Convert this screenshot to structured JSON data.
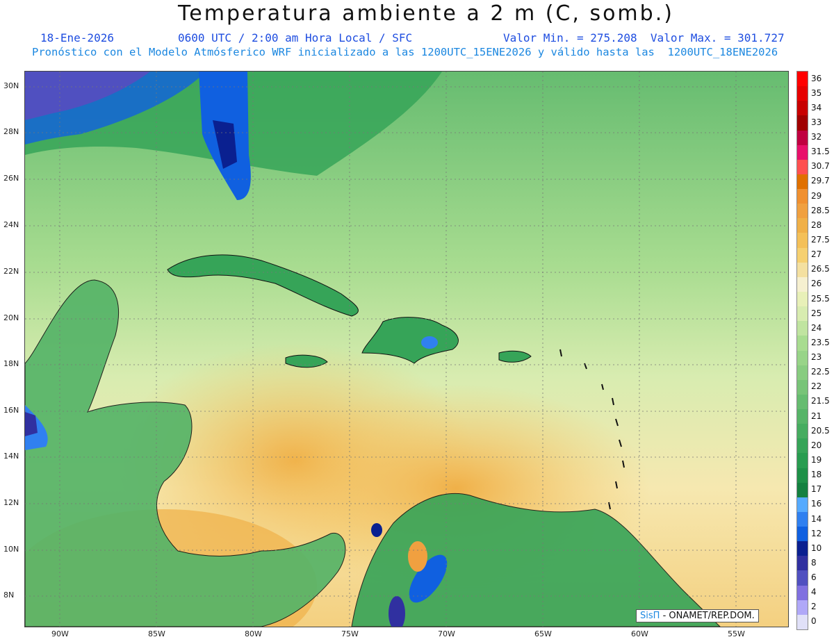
{
  "title": "Temperatura ambiente a 2 m (C, somb.)",
  "header": {
    "date": "18-Ene-2026",
    "time": "0600 UTC / 2:00 am Hora Local / SFC",
    "values": "Valor Min. = 275.208  Valor Max. = 301.727",
    "forecast": "Pronóstico con el Modelo Atmósferico WRF inicializado a las 1200UTC_15ENE2026 y válido hasta las  1200UTC_18ENE2026"
  },
  "axes": {
    "lat_labels": [
      "30N",
      "28N",
      "26N",
      "24N",
      "22N",
      "20N",
      "18N",
      "16N",
      "14N",
      "12N",
      "10N",
      "8N"
    ],
    "lon_labels": [
      "90W",
      "85W",
      "80W",
      "75W",
      "70W",
      "65W",
      "60W",
      "55W"
    ]
  },
  "colorbar": {
    "labels": [
      "36",
      "35",
      "34",
      "33",
      "32",
      "31.5",
      "30.7",
      "29.7",
      "29",
      "28.5",
      "28",
      "27.5",
      "27",
      "26.5",
      "26",
      "25.5",
      "25",
      "24",
      "23.5",
      "23",
      "22.5",
      "22",
      "21.5",
      "21",
      "20.5",
      "20",
      "19",
      "18",
      "17",
      "16",
      "14",
      "12",
      "10",
      "8",
      "6",
      "4",
      "2",
      "0"
    ],
    "colors": [
      "#ff0000",
      "#e60000",
      "#c80000",
      "#a00000",
      "#c00040",
      "#e8106a",
      "#ff5050",
      "#e07000",
      "#f09030",
      "#f0a040",
      "#f0b048",
      "#f4c058",
      "#f6d070",
      "#f4e0a0",
      "#f6f0d0",
      "#e8f0b8",
      "#d8ecb0",
      "#c0e4a0",
      "#a8dc90",
      "#98d488",
      "#88cc80",
      "#78c478",
      "#66bc70",
      "#56b468",
      "#46ac60",
      "#36a458",
      "#289c50",
      "#1e9048",
      "#148040",
      "#55aaff",
      "#3080f0",
      "#1060e0",
      "#0a2090",
      "#3030a0",
      "#5050c0",
      "#8070e0",
      "#b0a8f8",
      "#e0e0f8"
    ]
  },
  "credit": {
    "brand": "SisΠ",
    "text": "- ONAMET/REP.DOM."
  },
  "colors": {
    "header_blue": "#1e4de0",
    "header_lightblue": "#1b87e0",
    "ocean_warm": "#f0c060",
    "land_green": "#5cb060"
  }
}
